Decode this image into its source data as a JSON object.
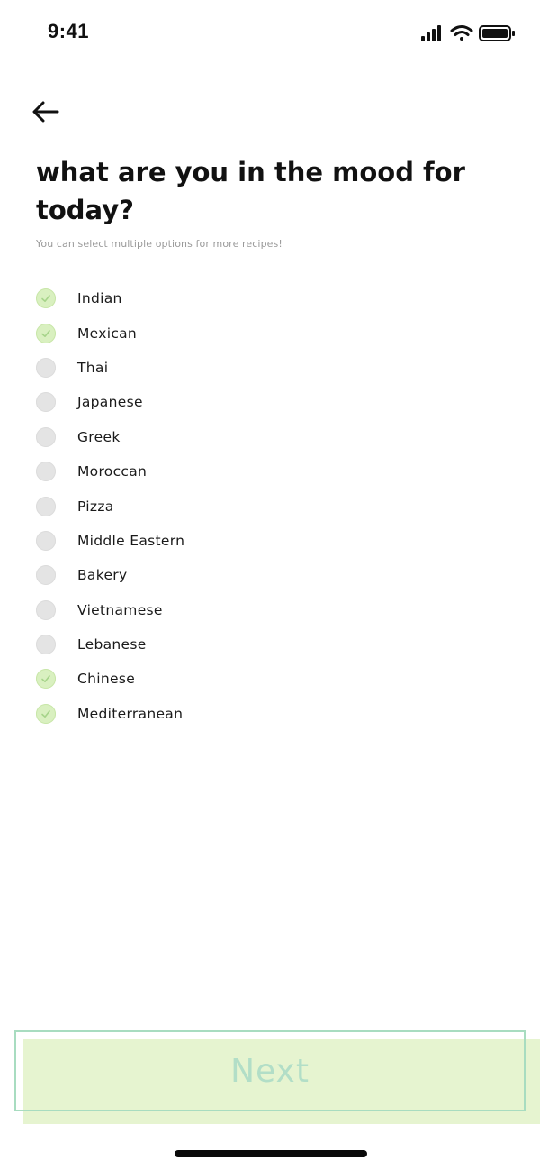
{
  "status_bar": {
    "time": "9:41",
    "icons": [
      "cellular-signal-icon",
      "wifi-icon",
      "battery-icon"
    ]
  },
  "header": {
    "back_icon": "arrow-left-icon",
    "title": "what are you in the mood for today?",
    "subtitle": "You can select multiple options for more recipes!"
  },
  "options": [
    {
      "label": "Indian",
      "selected": true
    },
    {
      "label": "Mexican",
      "selected": true
    },
    {
      "label": "Thai",
      "selected": false
    },
    {
      "label": "Japanese",
      "selected": false
    },
    {
      "label": "Greek",
      "selected": false
    },
    {
      "label": "Moroccan",
      "selected": false
    },
    {
      "label": "Pizza",
      "selected": false
    },
    {
      "label": "Middle Eastern",
      "selected": false
    },
    {
      "label": "Bakery",
      "selected": false
    },
    {
      "label": "Vietnamese",
      "selected": false
    },
    {
      "label": "Lebanese",
      "selected": false
    },
    {
      "label": "Chinese",
      "selected": true
    },
    {
      "label": "Mediterranean",
      "selected": true
    }
  ],
  "footer": {
    "next_label": "Next"
  },
  "colors": {
    "selected_fill": "#d9f0c0",
    "unselected_fill": "#e4e4e4",
    "button_border": "#a8dcc0",
    "button_text": "#b2dec7",
    "button_shadow": "#e6f4d0"
  }
}
